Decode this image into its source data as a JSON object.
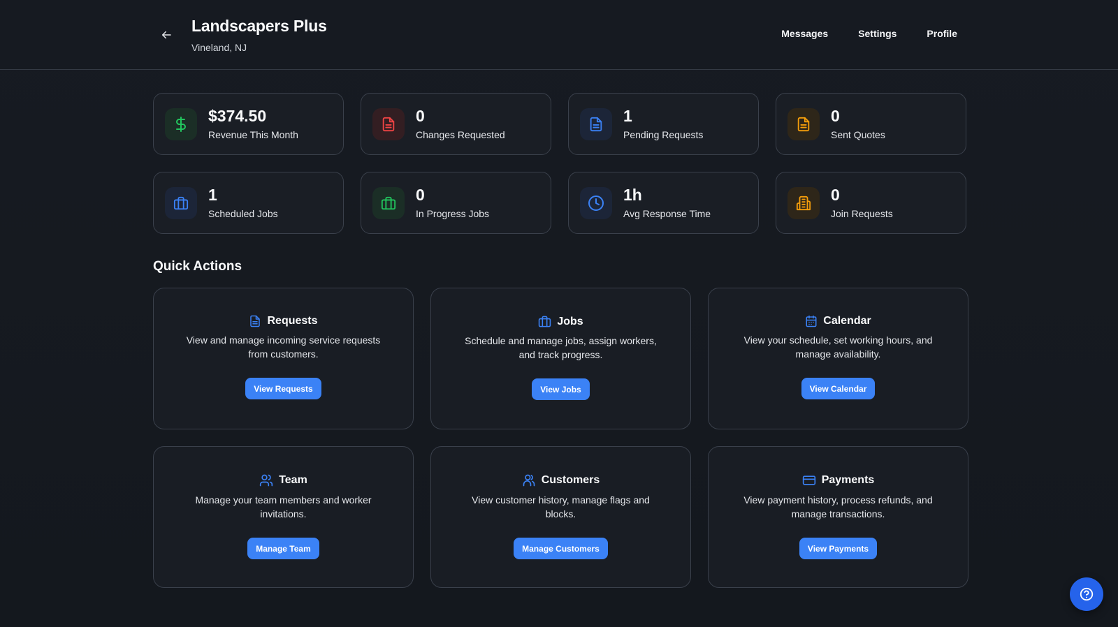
{
  "header": {
    "title": "Landscapers Plus",
    "location": "Vineland, NJ",
    "nav": [
      "Messages",
      "Settings",
      "Profile"
    ]
  },
  "stats": [
    {
      "value": "$374.50",
      "label": "Revenue This Month",
      "icon": "dollar-icon",
      "color": "#22c55e",
      "bg": "#1b2e26"
    },
    {
      "value": "0",
      "label": "Changes Requested",
      "icon": "document-icon",
      "color": "#ef4444",
      "bg": "#331e22"
    },
    {
      "value": "1",
      "label": "Pending Requests",
      "icon": "document-icon",
      "color": "#3b82f6",
      "bg": "#1c2538"
    },
    {
      "value": "0",
      "label": "Sent Quotes",
      "icon": "document-icon",
      "color": "#f59e0b",
      "bg": "#2e2619"
    },
    {
      "value": "1",
      "label": "Scheduled Jobs",
      "icon": "briefcase-icon",
      "color": "#3b82f6",
      "bg": "#1c2538"
    },
    {
      "value": "0",
      "label": "In Progress Jobs",
      "icon": "briefcase-icon",
      "color": "#22c55e",
      "bg": "#1b2e26"
    },
    {
      "value": "1h",
      "label": "Avg Response Time",
      "icon": "clock-icon",
      "color": "#3b82f6",
      "bg": "#1c2538"
    },
    {
      "value": "0",
      "label": "Join Requests",
      "icon": "building-icon",
      "color": "#f59e0b",
      "bg": "#2e2619"
    }
  ],
  "quick_actions": {
    "title": "Quick Actions",
    "items": [
      {
        "title": "Requests",
        "desc": "View and manage incoming service requests from customers.",
        "button": "View Requests",
        "icon": "document-icon"
      },
      {
        "title": "Jobs",
        "desc": "Schedule and manage jobs, assign workers, and track progress.",
        "button": "View Jobs",
        "icon": "briefcase-icon"
      },
      {
        "title": "Calendar",
        "desc": "View your schedule, set working hours, and manage availability.",
        "button": "View Calendar",
        "icon": "calendar-icon"
      },
      {
        "title": "Team",
        "desc": "Manage your team members and worker invitations.",
        "button": "Manage Team",
        "icon": "users-icon"
      },
      {
        "title": "Customers",
        "desc": "View customer history, manage flags and blocks.",
        "button": "Manage Customers",
        "icon": "user-group-icon"
      },
      {
        "title": "Payments",
        "desc": "View payment history, process refunds, and manage transactions.",
        "button": "View Payments",
        "icon": "credit-card-icon"
      }
    ]
  },
  "accent": "#3b82f6"
}
